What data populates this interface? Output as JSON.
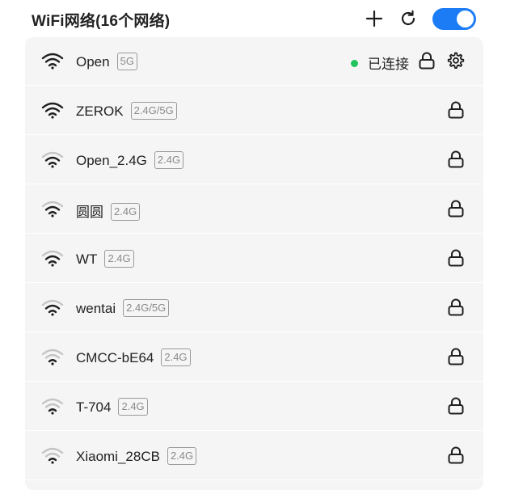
{
  "header": {
    "title": "WiFi网络(16个网络)",
    "wifi_enabled": true
  },
  "colors": {
    "accent": "#1b7cf5",
    "connected_dot": "#21c55d",
    "list_bg": "#f5f5f5"
  },
  "networks": [
    {
      "ssid": "Open",
      "band": "5G",
      "status": "已连接",
      "locked": true,
      "signal": 3
    },
    {
      "ssid": "ZEROK",
      "band": "2.4G/5G",
      "locked": true,
      "signal": 3
    },
    {
      "ssid": "Open_2.4G",
      "band": "2.4G",
      "locked": true,
      "signal": 2
    },
    {
      "ssid": "圆圆",
      "band": "2.4G",
      "locked": true,
      "signal": 2
    },
    {
      "ssid": "WT",
      "band": "2.4G",
      "locked": true,
      "signal": 2
    },
    {
      "ssid": "wentai",
      "band": "2.4G/5G",
      "locked": true,
      "signal": 2
    },
    {
      "ssid": "CMCC-bE64",
      "band": "2.4G",
      "locked": true,
      "signal": 1
    },
    {
      "ssid": "T-704",
      "band": "2.4G",
      "locked": true,
      "signal": 1
    },
    {
      "ssid": "Xiaomi_28CB",
      "band": "2.4G",
      "locked": true,
      "signal": 1
    }
  ],
  "icons": {
    "add": "plus-icon",
    "refresh": "refresh-icon",
    "wifi": "wifi-signal-icon",
    "lock": "lock-icon",
    "settings": "gear-icon"
  }
}
